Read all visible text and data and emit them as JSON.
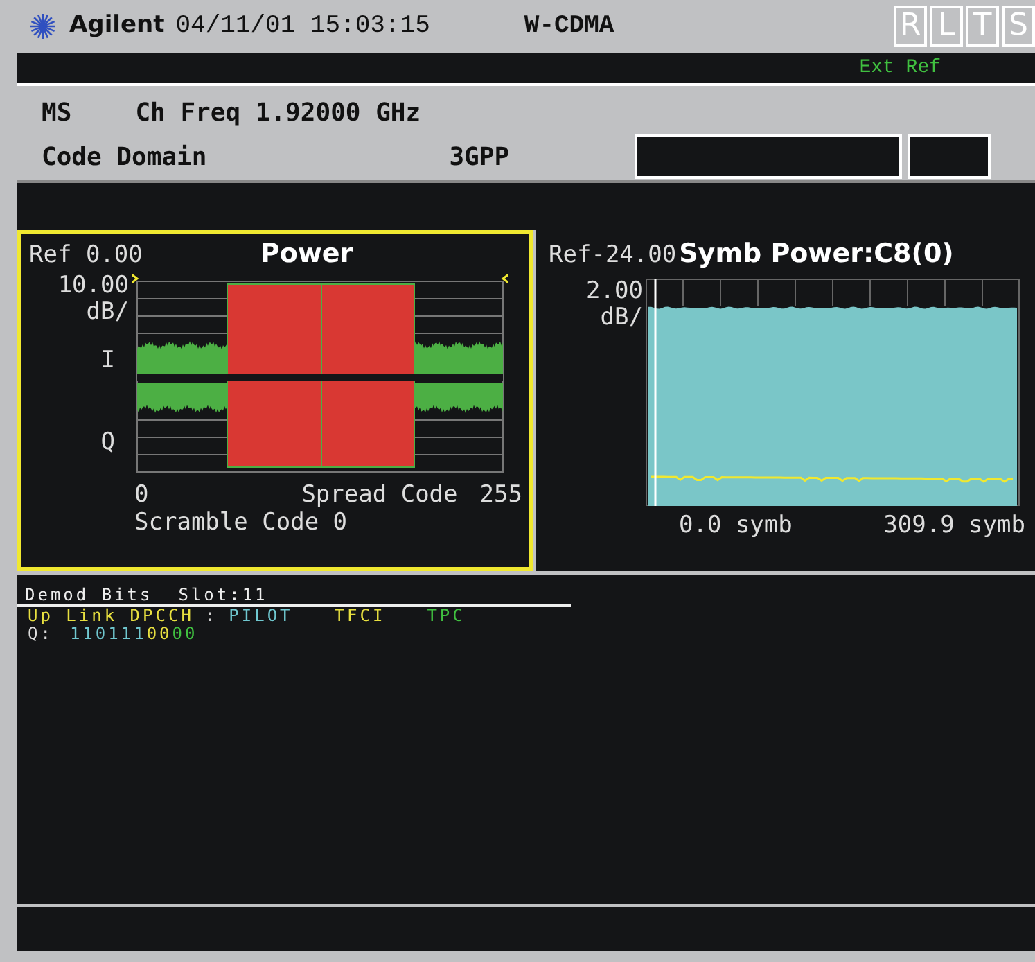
{
  "header": {
    "logo": "Agilent",
    "datetime": "04/11/01 15:03:15",
    "mode": "W-CDMA",
    "indicators": [
      {
        "label": "R"
      },
      {
        "label": "L"
      },
      {
        "label": "T"
      },
      {
        "label": "S"
      }
    ]
  },
  "status": {
    "ext_ref": "Ext Ref"
  },
  "info": {
    "line1": [
      "MS",
      "Ch Freq 1.92000 GHz"
    ],
    "line2": [
      "Code Domain",
      "3GPP"
    ]
  },
  "panels": [
    {
      "kind": "code-domain",
      "selected": true,
      "ref": "Ref 0.00",
      "title": "Power",
      "scale": "10.00",
      "unit": "dB/",
      "i_label": "I",
      "q_label": "Q",
      "x_start": "0",
      "x_label": "Spread Code",
      "x_end": "255",
      "footer": "Scramble Code 0"
    },
    {
      "kind": "symbol-power",
      "selected": false,
      "ref": "Ref-24.00",
      "title": "Symb Power:C8(0)",
      "scale": "2.00",
      "unit": "dB/",
      "x_start": "0.0 symb",
      "x_end": "309.9 symb"
    }
  ],
  "demod": {
    "title": "Demod Bits  Slot:11",
    "legend": [
      {
        "text": "Up Link DPCCH",
        "color": "#e8e040"
      },
      {
        "text": ":",
        "color": "#d0d0d0"
      },
      {
        "text": "PILOT",
        "color": "#70c8d0"
      },
      {
        "text": "TFCI",
        "color": "#e8e040"
      },
      {
        "text": "TPC",
        "color": "#40c040"
      }
    ],
    "q_label": "Q:",
    "bits": [
      {
        "text": "110111",
        "color": "#70c8d0"
      },
      {
        "text": "00",
        "color": "#e8e040"
      },
      {
        "text": "00",
        "color": "#40c040"
      }
    ]
  }
}
